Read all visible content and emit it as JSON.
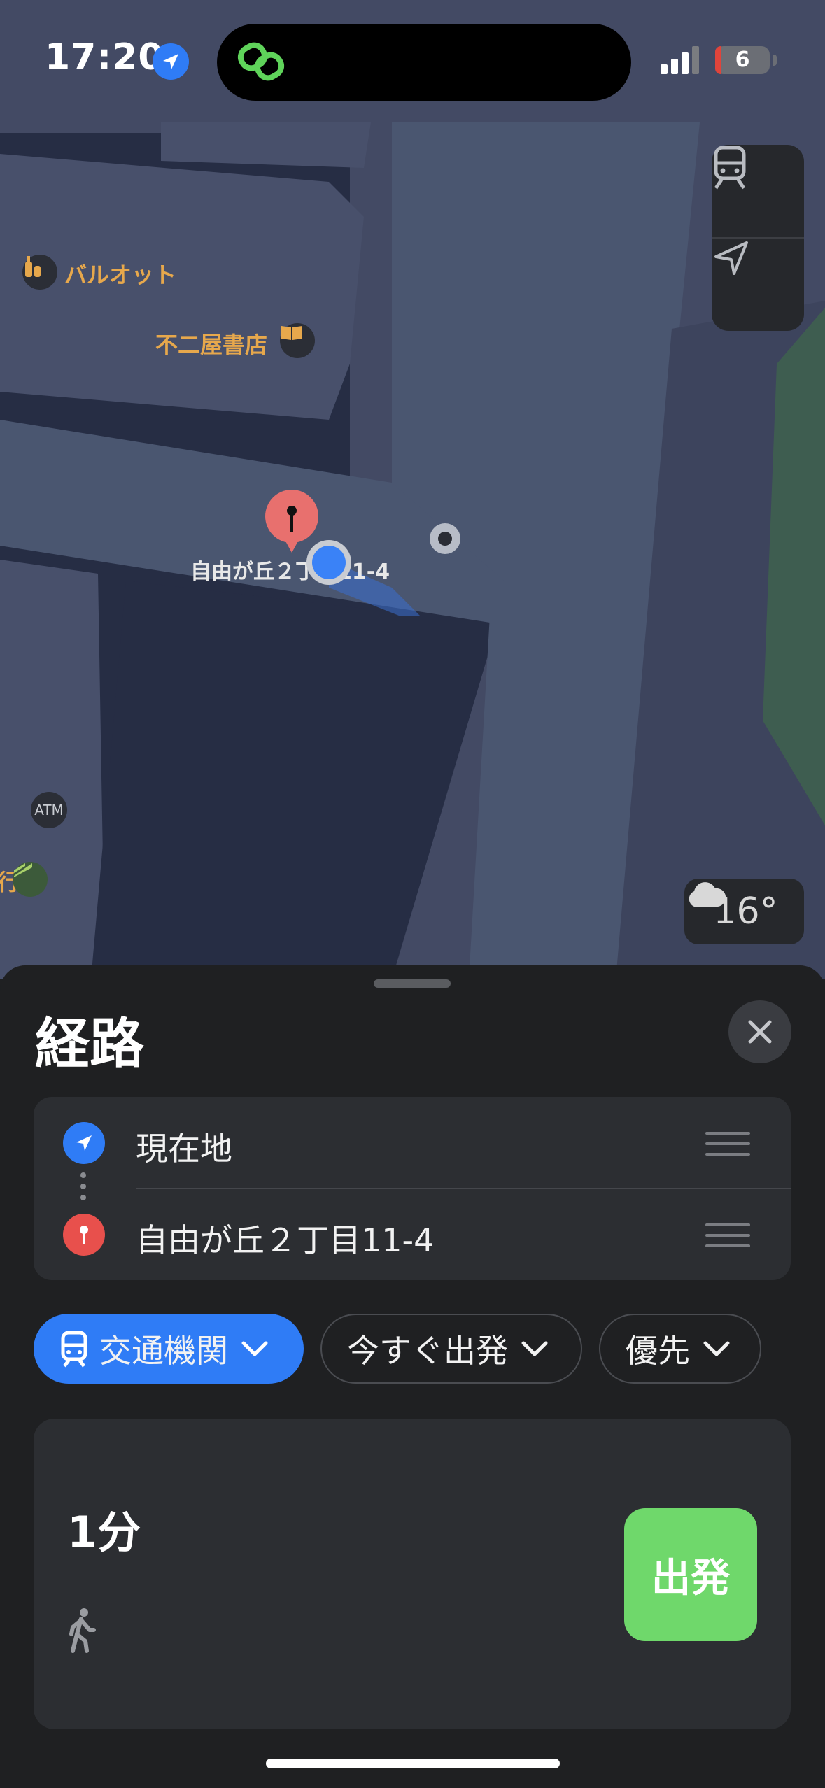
{
  "status_bar": {
    "time": "17:20",
    "battery": "6"
  },
  "map": {
    "pois": [
      {
        "name": "バルオット",
        "icon": "sake-bottle-icon"
      },
      {
        "name": "不二屋書店",
        "icon": "book-icon"
      }
    ],
    "atm_label": "ATM",
    "bank_label_fragment": "行",
    "destination_label": "自由が丘２丁目11-4",
    "weather": {
      "temperature": "16°",
      "icon": "cloud-icon"
    },
    "controls": {
      "transit_icon": "train-icon",
      "location_icon": "location-arrow-icon"
    }
  },
  "sheet": {
    "title": "経路",
    "route": {
      "from": "現在地",
      "to": "自由が丘２丁目11-4"
    },
    "chips": {
      "mode": "交通機関",
      "depart": "今すぐ出発",
      "prefer": "優先"
    },
    "result": {
      "duration": "1分",
      "go_label": "出発"
    }
  },
  "colors": {
    "accent": "#2f7cf6",
    "go": "#6fd86b",
    "pin": "#e8706e",
    "poi_label": "#e7a84c"
  }
}
